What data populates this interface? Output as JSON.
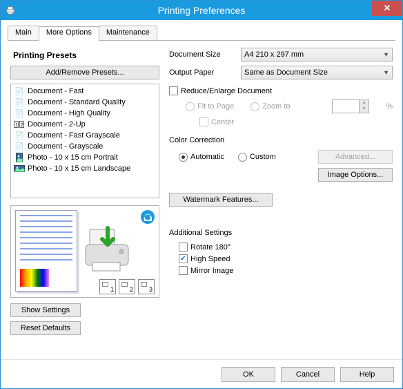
{
  "window": {
    "title": "Printing Preferences"
  },
  "tabs": {
    "main": "Main",
    "more": "More Options",
    "maint": "Maintenance"
  },
  "presets": {
    "heading": "Printing Presets",
    "addRemove": "Add/Remove Presets...",
    "items": [
      "Document - Fast",
      "Document - Standard Quality",
      "Document - High Quality",
      "Document - 2-Up",
      "Document - Fast Grayscale",
      "Document - Grayscale",
      "Photo - 10 x 15 cm Portrait",
      "Photo - 10 x 15 cm Landscape"
    ]
  },
  "doc": {
    "sizeLabel": "Document Size",
    "sizeValue": "A4 210 x 297 mm",
    "outLabel": "Output Paper",
    "outValue": "Same as Document Size"
  },
  "reduce": {
    "label": "Reduce/Enlarge Document",
    "fit": "Fit to Page",
    "zoom": "Zoom to",
    "center": "Center",
    "pct": "%"
  },
  "color": {
    "title": "Color Correction",
    "auto": "Automatic",
    "custom": "Custom",
    "advanced": "Advanced...",
    "imgopt": "Image Options..."
  },
  "watermark": "Watermark Features...",
  "additional": {
    "title": "Additional Settings",
    "rotate": "Rotate 180°",
    "high": "High Speed",
    "mirror": "Mirror Image"
  },
  "buttons": {
    "show": "Show Settings",
    "reset": "Reset Defaults",
    "ok": "OK",
    "cancel": "Cancel",
    "help": "Help"
  }
}
